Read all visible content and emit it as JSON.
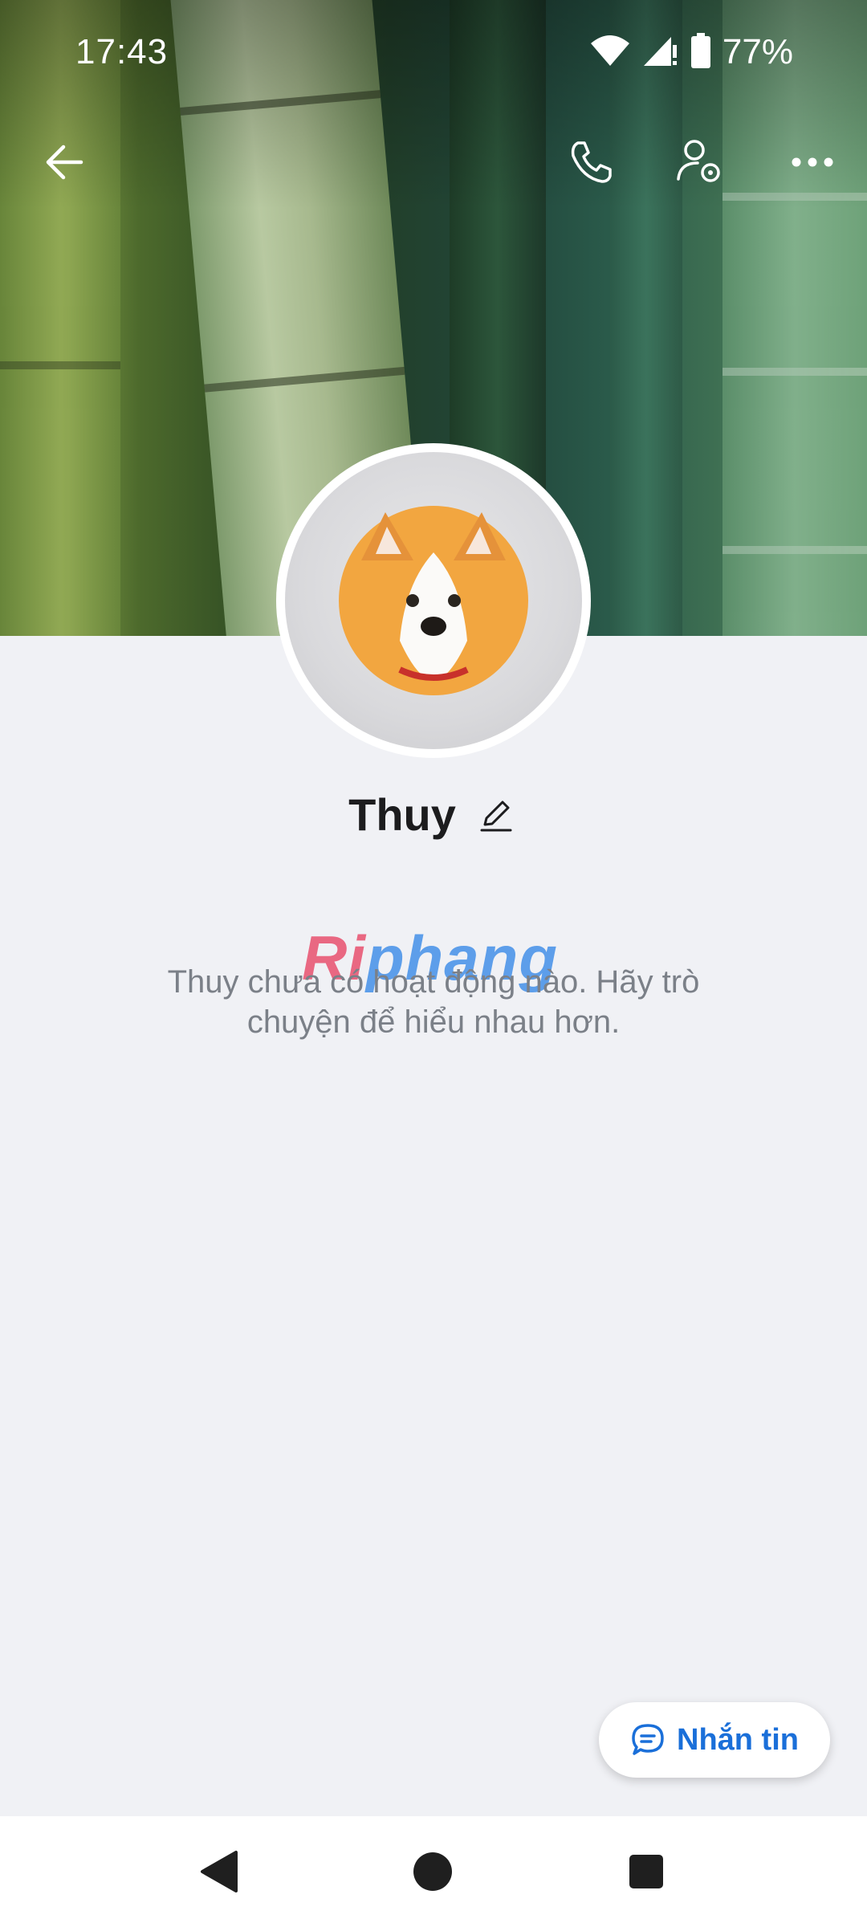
{
  "status_bar": {
    "time": "17:43",
    "battery_percent": "77%",
    "icons": [
      "wifi-icon",
      "cell-signal-icon",
      "battery-icon"
    ]
  },
  "top_bar": {
    "icons": [
      "back-arrow-icon",
      "phone-icon",
      "user-settings-icon",
      "more-icon"
    ]
  },
  "profile": {
    "name": "Thuy",
    "empty_message": "Thuy chưa có hoạt động nào. Hãy trò chuyện để hiểu nhau hơn."
  },
  "watermark": {
    "part1": "Ri",
    "part2": "phang"
  },
  "message_button": {
    "label": "Nhắn tin",
    "icon": "chat-bubble-icon"
  },
  "nav_bar": {
    "icons": [
      "nav-back-icon",
      "nav-home-icon",
      "nav-recents-icon"
    ]
  },
  "colors": {
    "background": "#f0f1f5",
    "accent": "#1a6fd9",
    "text_primary": "#1c1c1e",
    "text_secondary": "#7b8088"
  }
}
